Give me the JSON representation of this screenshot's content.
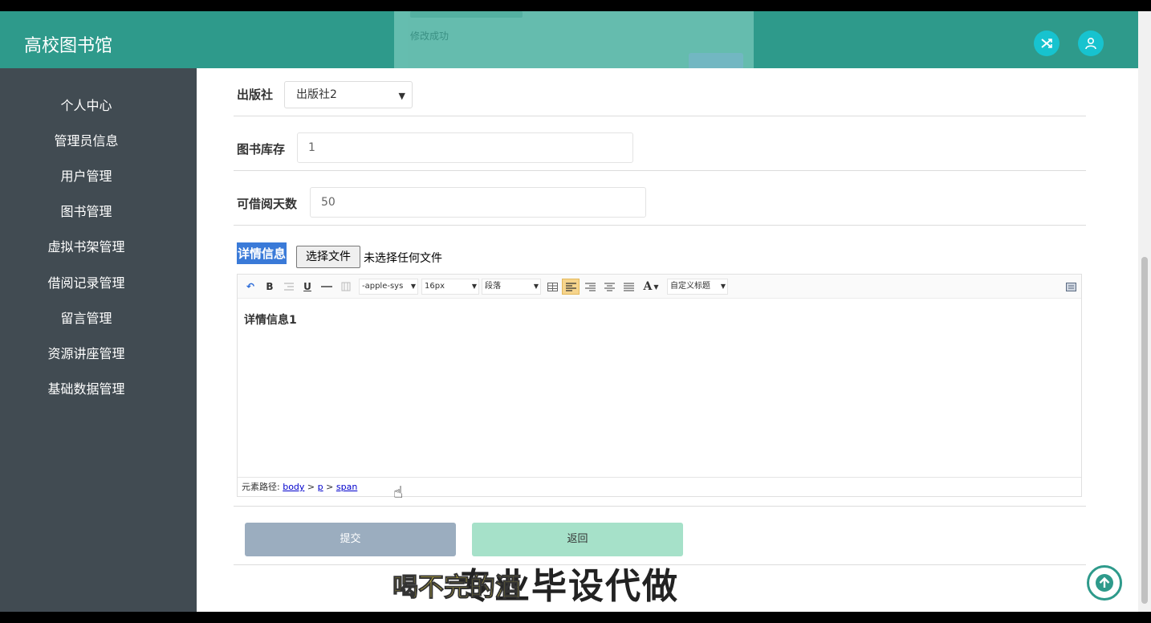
{
  "app": {
    "title": "高校图书馆"
  },
  "header": {
    "shuffle_icon": "shuffle-icon",
    "user_icon": "user-icon"
  },
  "toast": {
    "text": "修改成功"
  },
  "sidebar": {
    "items": [
      {
        "label": "个人中心"
      },
      {
        "label": "管理员信息"
      },
      {
        "label": "用户管理"
      },
      {
        "label": "图书管理"
      },
      {
        "label": "虚拟书架管理"
      },
      {
        "label": "借阅记录管理"
      },
      {
        "label": "留言管理"
      },
      {
        "label": "资源讲座管理"
      },
      {
        "label": "基础数据管理"
      }
    ]
  },
  "form": {
    "publisher": {
      "label": "出版社",
      "value": "出版社2"
    },
    "stock": {
      "label": "图书库存",
      "value": "1"
    },
    "borrow_days": {
      "label": "可借阅天数",
      "value": "50"
    },
    "detail": {
      "label": "详情信息",
      "file_button": "选择文件",
      "file_status": "未选择任何文件",
      "content": "详情信息1"
    }
  },
  "editor": {
    "toolbar": {
      "undo": "↶",
      "bold": "B",
      "underline": "U",
      "font_family": "-apple-sys",
      "font_size": "16px",
      "paragraph": "段落",
      "font_color": "A",
      "custom_title": "自定义标题"
    },
    "statusbar": {
      "prefix": "元素路径:",
      "path": [
        "body",
        "p",
        "span"
      ]
    }
  },
  "buttons": {
    "submit": "提交",
    "back": "返回"
  },
  "subtitles": {
    "yellow": "喝不完的酒",
    "black": "专业毕设代做"
  }
}
